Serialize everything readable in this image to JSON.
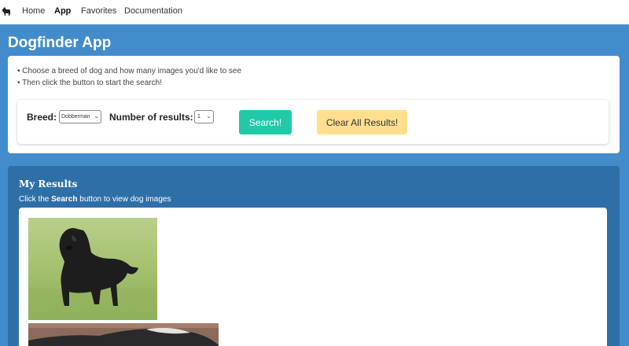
{
  "nav": {
    "logo_icon": "dog-icon",
    "links": [
      "Home",
      "App",
      "Favorites",
      "Documentation"
    ],
    "active": "App"
  },
  "app": {
    "title": "Dogfinder App",
    "instructions": [
      "• Choose a breed of dog and how many images you'd like to see",
      "• Then click the button to start the search!"
    ]
  },
  "form": {
    "breed_label": "Breed:",
    "breed_value": "Dobberman",
    "results_label": "Number of results:",
    "results_value": "1",
    "search_label": "Search!",
    "clear_label": "Clear All Results!"
  },
  "results": {
    "heading": "My Results",
    "hint_prefix": "Click the ",
    "hint_bold": "Search",
    "hint_suffix": " button to view dog images",
    "images": [
      "dog-photo-black-terrier",
      "dog-photo-partial"
    ]
  },
  "colors": {
    "page_blue": "#438ccb",
    "panel_blue": "#2f6fa7",
    "search_green": "#20c9a8",
    "clear_yellow": "#ffdf8e"
  }
}
